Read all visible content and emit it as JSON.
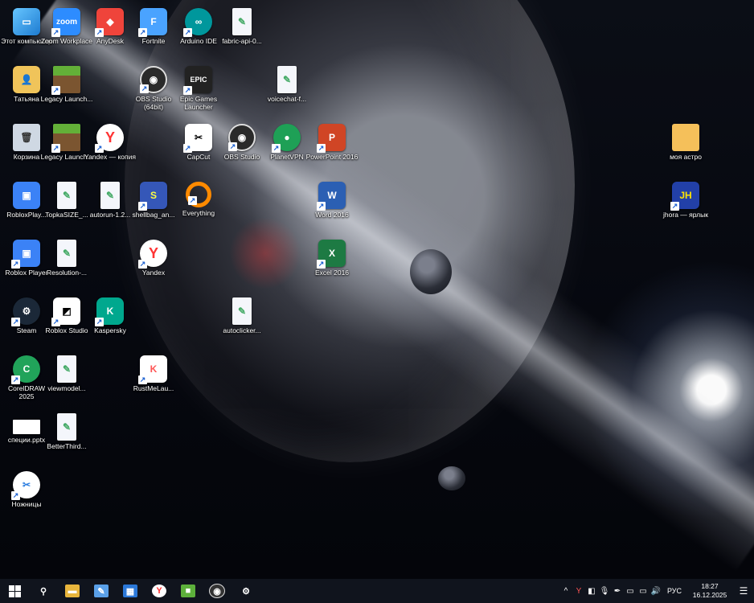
{
  "desktop": {
    "icons": [
      {
        "label": "Этот компьютер",
        "glyph": "▭",
        "icon": "computer-icon",
        "shortcut": false
      },
      {
        "label": "Zoom Workplace",
        "glyph": "zoom",
        "icon": "zoom-icon",
        "shortcut": true
      },
      {
        "label": "AnyDesk",
        "glyph": "◆",
        "icon": "anydesk-icon",
        "shortcut": true
      },
      {
        "label": "Fortnite",
        "glyph": "F",
        "icon": "fortnite-icon",
        "shortcut": true
      },
      {
        "label": "Arduino IDE",
        "glyph": "∞",
        "icon": "arduino-icon",
        "shortcut": true
      },
      {
        "label": "fabric-api-0...",
        "glyph": "✎",
        "icon": "file-icon",
        "shortcut": false
      },
      {
        "label": "Татьяна",
        "glyph": "👤",
        "icon": "user-folder-icon",
        "shortcut": false
      },
      {
        "label": "Legacy Launch...",
        "glyph": "",
        "icon": "minecraft-launcher-icon",
        "shortcut": true
      },
      {
        "label": "OBS Studio (64bit)",
        "glyph": "◉",
        "icon": "obs-icon",
        "shortcut": true
      },
      {
        "label": "Epic Games Launcher",
        "glyph": "EPIC",
        "icon": "epic-games-icon",
        "shortcut": true
      },
      {
        "label": "voicechat-f...",
        "glyph": "✎",
        "icon": "file-icon",
        "shortcut": false
      },
      {
        "label": "Корзина",
        "glyph": "🗑",
        "icon": "recycle-bin-icon",
        "shortcut": false
      },
      {
        "label": "Legacy Launch...",
        "glyph": "",
        "icon": "minecraft-launcher-icon",
        "shortcut": true
      },
      {
        "label": "Yandex — копия",
        "glyph": "Y",
        "icon": "yandex-icon",
        "shortcut": true
      },
      {
        "label": "CapCut",
        "glyph": "✂",
        "icon": "capcut-icon",
        "shortcut": true
      },
      {
        "label": "OBS Studio",
        "glyph": "◉",
        "icon": "obs-icon",
        "shortcut": true
      },
      {
        "label": "PlanetVPN",
        "glyph": "●",
        "icon": "planetvpn-icon",
        "shortcut": true
      },
      {
        "label": "PowerPoint 2016",
        "glyph": "P",
        "icon": "powerpoint-icon",
        "shortcut": true
      },
      {
        "label": "моя астро",
        "glyph": "",
        "icon": "folder-icon",
        "shortcut": false
      },
      {
        "label": "RobloxPlay...",
        "glyph": "▣",
        "icon": "roblox-icon",
        "shortcut": false
      },
      {
        "label": "TopkaSIZE_...",
        "glyph": "✎",
        "icon": "file-icon",
        "shortcut": false
      },
      {
        "label": "autorun-1.2...",
        "glyph": "✎",
        "icon": "file-icon",
        "shortcut": false
      },
      {
        "label": "shellbag_an...",
        "glyph": "S",
        "icon": "shellbag-icon",
        "shortcut": true
      },
      {
        "label": "Everything",
        "glyph": "",
        "icon": "everything-icon",
        "shortcut": true
      },
      {
        "label": "Word 2016",
        "glyph": "W",
        "icon": "word-icon",
        "shortcut": true
      },
      {
        "label": "jhora — ярлык",
        "glyph": "JH",
        "icon": "jhora-icon",
        "shortcut": true
      },
      {
        "label": "Roblox Player",
        "glyph": "▣",
        "icon": "roblox-icon",
        "shortcut": true
      },
      {
        "label": "Resolution-...",
        "glyph": "✎",
        "icon": "file-icon",
        "shortcut": false
      },
      {
        "label": "Yandex",
        "glyph": "Y",
        "icon": "yandex-icon",
        "shortcut": true
      },
      {
        "label": "Excel 2016",
        "glyph": "X",
        "icon": "excel-icon",
        "shortcut": true
      },
      {
        "label": "Steam",
        "glyph": "⚙",
        "icon": "steam-icon",
        "shortcut": true
      },
      {
        "label": "Roblox Studio",
        "glyph": "◩",
        "icon": "roblox-studio-icon",
        "shortcut": true
      },
      {
        "label": "Kaspersky",
        "glyph": "K",
        "icon": "kaspersky-icon",
        "shortcut": true
      },
      {
        "label": "autoclicker...",
        "glyph": "✎",
        "icon": "file-icon",
        "shortcut": false
      },
      {
        "label": "CorelDRAW 2025",
        "glyph": "C",
        "icon": "coreldraw-icon",
        "shortcut": true
      },
      {
        "label": "viewmodel...",
        "glyph": "✎",
        "icon": "file-icon",
        "shortcut": false
      },
      {
        "label": "RustMeLau...",
        "glyph": "K",
        "icon": "rustme-launcher-icon",
        "shortcut": true
      },
      {
        "label": "специи.pptx",
        "glyph": "",
        "icon": "pptx-file-icon",
        "shortcut": false
      },
      {
        "label": "BetterThird...",
        "glyph": "✎",
        "icon": "file-icon",
        "shortcut": false
      },
      {
        "label": "Ножницы",
        "glyph": "✂",
        "icon": "snipping-tool-icon",
        "shortcut": true
      }
    ]
  },
  "taskbar": {
    "pinned": [
      {
        "icon": "search-icon",
        "glyph": "⚲"
      },
      {
        "icon": "file-explorer-icon",
        "glyph": "▬"
      },
      {
        "icon": "paint-icon",
        "glyph": "✎"
      },
      {
        "icon": "microsoft-store-icon",
        "glyph": "▦"
      },
      {
        "icon": "yandex-browser-icon",
        "glyph": "Y"
      },
      {
        "icon": "minecraft-icon",
        "glyph": "■"
      },
      {
        "icon": "obs-taskbar-icon",
        "glyph": "◉"
      },
      {
        "icon": "settings-icon",
        "glyph": "⚙"
      }
    ],
    "tray": [
      {
        "icon": "chevron-up-icon",
        "glyph": "^"
      },
      {
        "icon": "yandex-tray-icon",
        "glyph": "Y"
      },
      {
        "icon": "webcam-icon",
        "glyph": "◧"
      },
      {
        "icon": "microphone-icon",
        "glyph": "🎙"
      },
      {
        "icon": "pen-icon",
        "glyph": "✒"
      },
      {
        "icon": "network-icon",
        "glyph": "▭"
      },
      {
        "icon": "battery-icon",
        "glyph": "▭"
      },
      {
        "icon": "volume-icon",
        "glyph": "🔊"
      }
    ],
    "language": "РУС",
    "time": "18:27",
    "date": "16.12.2025",
    "notification_glyph": "☰"
  }
}
